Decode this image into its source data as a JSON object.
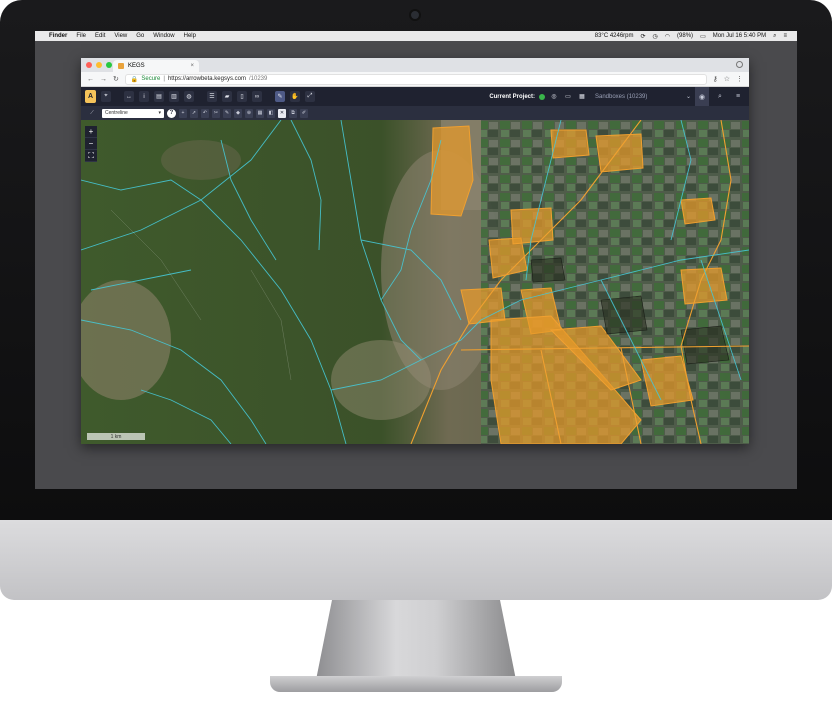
{
  "menubar": {
    "app_name": "Finder",
    "items": [
      "File",
      "Edit",
      "View",
      "Go",
      "Window",
      "Help"
    ],
    "status_temp": "83°C 4246rpm",
    "battery": "(98%)",
    "datetime": "Mon Jul 16  5:40 PM"
  },
  "browser": {
    "tab_title": "KEGS",
    "secure_label": "Secure",
    "url_host": "https://arrowbeta.kegsys.com",
    "url_path": "/10239"
  },
  "app": {
    "logo_letter": "A",
    "current_project_label": "Current Project:",
    "project_name": "Sandboxes (10239)",
    "layer_select_value": "Centreline"
  },
  "map": {
    "zoom_in": "+",
    "zoom_out": "−",
    "scale_label": "1 km"
  },
  "colors": {
    "toolbar_bg": "#1f2230",
    "accent_orange": "#f0a030",
    "waterway_cyan": "#46c8d6",
    "project_dot": "#39b54a"
  }
}
